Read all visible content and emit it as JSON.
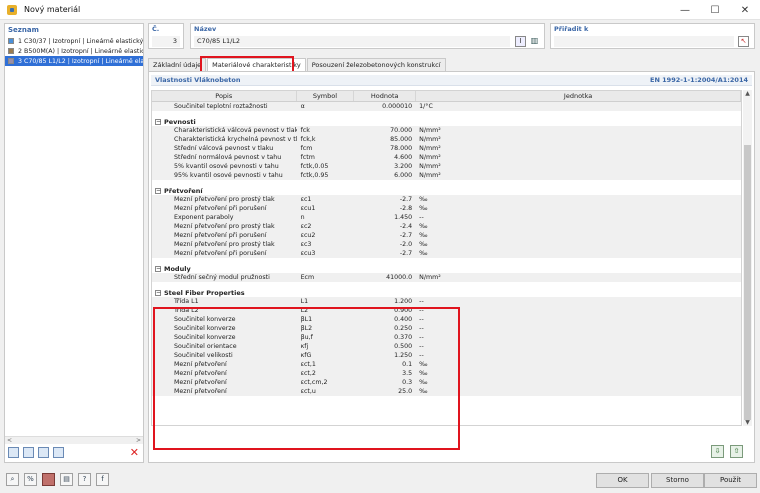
{
  "window": {
    "title": "Nový materiál",
    "minimize": "—",
    "maximize": "☐",
    "close": "✕"
  },
  "list": {
    "header": "Seznam",
    "items": [
      {
        "text": "1  C30/37 | Izotropní | Lineárně elastický",
        "color": "#4a90d9"
      },
      {
        "text": "2  B500M(A) | Izotropní | Lineárně elastick",
        "color": "#9a7b4f"
      },
      {
        "text": "3  C70/85 L1/L2 | Izotropní | Lineárně ela",
        "color": "#9b8fa8"
      }
    ],
    "scroll_left": "<",
    "scroll_right": ">",
    "delete_icon": "✕"
  },
  "number": {
    "label": "Č.",
    "value": "3"
  },
  "name": {
    "label": "Název",
    "value": "C70/85 L1/L2"
  },
  "assigned": {
    "label": "Přiřadit k",
    "value": ""
  },
  "tabs": [
    {
      "label": "Základní údaje"
    },
    {
      "label": "Materiálové charakteristiky"
    },
    {
      "label": "Posouzení železobetonových konstrukcí"
    }
  ],
  "section": {
    "title": "Vlastnosti Vláknobeton",
    "norm": "EN 1992-1-1:2004/A1:2014"
  },
  "grid": {
    "headers": {
      "popis": "Popis",
      "symbol": "Symbol",
      "hodnota": "Hodnota",
      "jednotka": "Jednotka"
    },
    "top_rows": [
      {
        "popis": "Součinitel teplotní roztažnosti",
        "symbol": "α",
        "value": "0.000010",
        "unit": "1/°C"
      }
    ],
    "groups": [
      {
        "name": "Pevnosti",
        "rows": [
          {
            "popis": "Charakteristická válcová pevnost v tlaku",
            "symbol": "fck",
            "value": "70.000",
            "unit": "N/mm²"
          },
          {
            "popis": "Charakteristická krychelná pevnost v tla...",
            "symbol": "fck,k",
            "value": "85.000",
            "unit": "N/mm²"
          },
          {
            "popis": "Střední válcová pevnost v tlaku",
            "symbol": "fcm",
            "value": "78.000",
            "unit": "N/mm²"
          },
          {
            "popis": "Střední normálová pevnost v tahu",
            "symbol": "fctm",
            "value": "4.600",
            "unit": "N/mm²"
          },
          {
            "popis": "5% kvantil osové pevnosti v tahu",
            "symbol": "fctk,0.05",
            "value": "3.200",
            "unit": "N/mm²"
          },
          {
            "popis": "95% kvantil osové pevnosti v tahu",
            "symbol": "fctk,0.95",
            "value": "6.000",
            "unit": "N/mm²"
          }
        ]
      },
      {
        "name": "Přetvoření",
        "rows": [
          {
            "popis": "Mezní přetvoření pro prostý tlak",
            "symbol": "εc1",
            "value": "-2.7",
            "unit": "‰"
          },
          {
            "popis": "Mezní přetvoření při porušení",
            "symbol": "εcu1",
            "value": "-2.8",
            "unit": "‰"
          },
          {
            "popis": "Exponent paraboly",
            "symbol": "n",
            "value": "1.450",
            "unit": "--"
          },
          {
            "popis": "Mezní přetvoření pro prostý tlak",
            "symbol": "εc2",
            "value": "-2.4",
            "unit": "‰"
          },
          {
            "popis": "Mezní přetvoření při porušení",
            "symbol": "εcu2",
            "value": "-2.7",
            "unit": "‰"
          },
          {
            "popis": "Mezní přetvoření pro prostý tlak",
            "symbol": "εc3",
            "value": "-2.0",
            "unit": "‰"
          },
          {
            "popis": "Mezní přetvoření při porušení",
            "symbol": "εcu3",
            "value": "-2.7",
            "unit": "‰"
          }
        ]
      },
      {
        "name": "Moduly",
        "rows": [
          {
            "popis": "Střední sečný modul pružnosti",
            "symbol": "Ecm",
            "value": "41000.0",
            "unit": "N/mm²"
          }
        ]
      },
      {
        "name": "Steel Fiber Properties",
        "rows": [
          {
            "popis": "Třída L1",
            "symbol": "L1",
            "value": "1.200",
            "unit": "--"
          },
          {
            "popis": "Třída L2",
            "symbol": "L2",
            "value": "0.900",
            "unit": "--"
          },
          {
            "popis": "Součinitel konverze",
            "symbol": "βL1",
            "value": "0.400",
            "unit": "--"
          },
          {
            "popis": "Součinitel konverze",
            "symbol": "βL2",
            "value": "0.250",
            "unit": "--"
          },
          {
            "popis": "Součinitel konverze",
            "symbol": "βu,f",
            "value": "0.370",
            "unit": "--"
          },
          {
            "popis": "Součinitel orientace",
            "symbol": "κfj",
            "value": "0.500",
            "unit": "--"
          },
          {
            "popis": "Součinitel velikosti",
            "symbol": "κfG",
            "value": "1.250",
            "unit": "--"
          },
          {
            "popis": "Mezní přetvoření",
            "symbol": "εct,1",
            "value": "0.1",
            "unit": "‰"
          },
          {
            "popis": "Mezní přetvoření",
            "symbol": "εct,2",
            "value": "3.5",
            "unit": "‰"
          },
          {
            "popis": "Mezní přetvoření",
            "symbol": "εct,cm,2",
            "value": "0.3",
            "unit": "‰"
          },
          {
            "popis": "Mezní přetvoření",
            "symbol": "εct,u",
            "value": "25.0",
            "unit": "‰"
          }
        ]
      }
    ]
  },
  "buttons": {
    "ok": "OK",
    "cancel": "Storno",
    "apply": "Použít"
  }
}
